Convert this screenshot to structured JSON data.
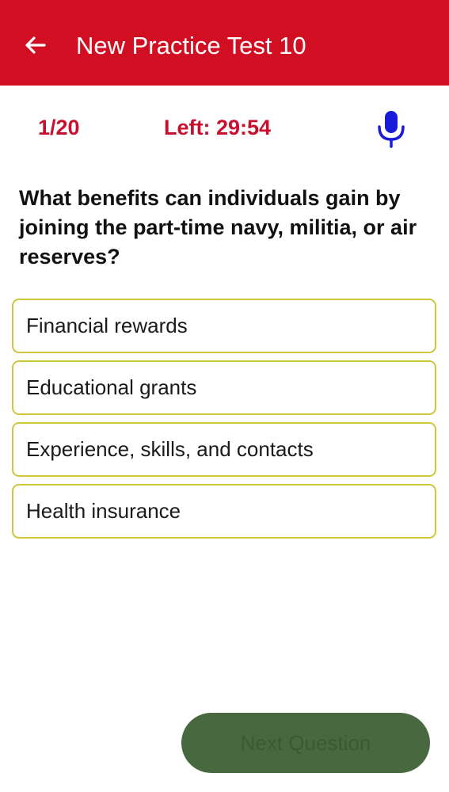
{
  "header": {
    "back_icon": "arrow-left-icon",
    "title": "New Practice Test 10",
    "background": "#d20f22"
  },
  "status": {
    "counter": "1/20",
    "timer": "Left: 29:54",
    "mic_icon": "microphone-icon",
    "accent": "#c8102e",
    "mic_color": "#1a1adb"
  },
  "question": {
    "text": "What benefits can individuals gain by joining the part-time navy, militia, or air reserves?"
  },
  "options": [
    {
      "label": "Financial rewards"
    },
    {
      "label": "Educational grants"
    },
    {
      "label": "Experience, skills, and contacts"
    },
    {
      "label": "Health insurance"
    }
  ],
  "footer": {
    "next_label": "Next Question",
    "button_color": "#48693f"
  }
}
